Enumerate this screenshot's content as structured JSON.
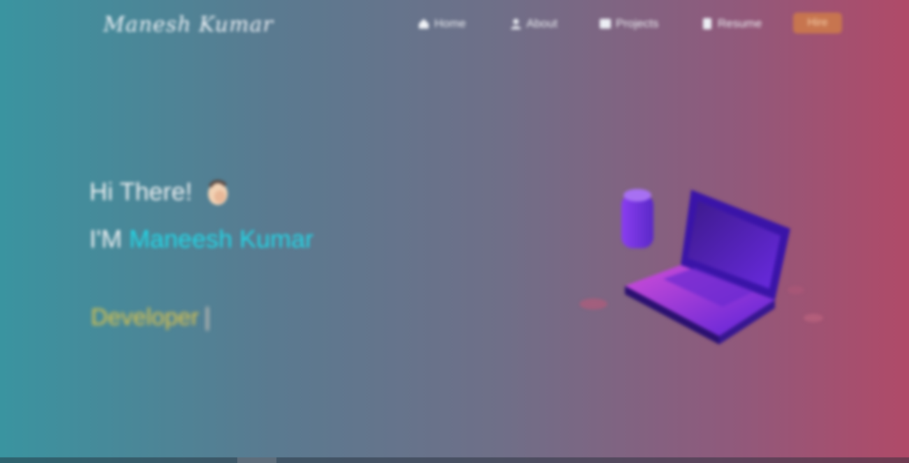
{
  "header": {
    "logo_text": "Manesh Kumar",
    "nav": {
      "home": {
        "label": "Home",
        "icon": "home-icon"
      },
      "about": {
        "label": "About",
        "icon": "user-icon"
      },
      "projects": {
        "label": "Projects",
        "icon": "projects-icon"
      },
      "resume": {
        "label": "Resume",
        "icon": "document-icon"
      },
      "cta_label": "Hire"
    }
  },
  "hero": {
    "greeting": "Hi There!",
    "greeting_icon": "waving-hand-icon",
    "intro_prefix": "I'M",
    "name": "Maneesh Kumar",
    "typed_role": "Developer"
  },
  "illustration": {
    "icon": "laptop-coffee-illustration"
  },
  "colors": {
    "bg_left": "#3a94a0",
    "bg_right": "#b04a68",
    "name_accent": "#22d8e8",
    "role_accent": "#e3c64a",
    "cta_bg": "#c7754f"
  }
}
